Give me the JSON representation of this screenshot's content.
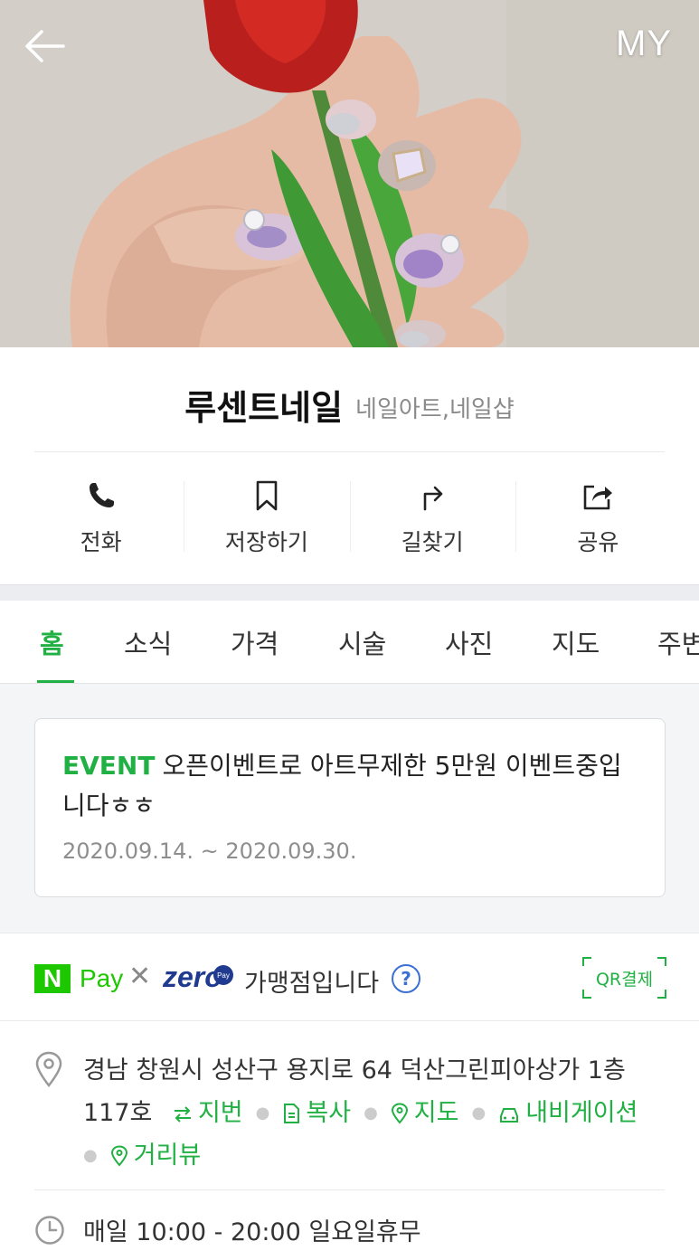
{
  "header": {
    "my_label": "MY"
  },
  "place": {
    "name": "루센트네일",
    "category": "네일아트,네일샵"
  },
  "actions": [
    {
      "label": "전화",
      "icon": "phone-icon"
    },
    {
      "label": "저장하기",
      "icon": "bookmark-icon"
    },
    {
      "label": "길찾기",
      "icon": "directions-icon"
    },
    {
      "label": "공유",
      "icon": "share-icon"
    }
  ],
  "tabs": [
    {
      "label": "홈",
      "active": true
    },
    {
      "label": "소식"
    },
    {
      "label": "가격"
    },
    {
      "label": "시술"
    },
    {
      "label": "사진"
    },
    {
      "label": "지도"
    },
    {
      "label": "주변"
    }
  ],
  "event": {
    "tag": "EVENT",
    "text": "오픈이벤트로 아트무제한 5만원 이벤트중입니다ㅎㅎ",
    "date": "2020.09.14. ~ 2020.09.30."
  },
  "pay": {
    "npay_logo": "N",
    "npay_text": "Pay",
    "times": "✕",
    "zero_text": "zero",
    "zero_badge": "Pay",
    "member_text": "가맹점입니다",
    "help": "?",
    "qr_label": "QR결제"
  },
  "address": {
    "text": "경남 창원시 성산구 용지로 64 덕산그린피아상가 1층 117호",
    "links": [
      "지번",
      "복사",
      "지도",
      "내비게이션",
      "거리뷰"
    ]
  },
  "hours": {
    "text": "매일 10:00 - 20:00 일요일휴무"
  },
  "colors": {
    "accent": "#21b043",
    "npay": "#1ec800",
    "zeropay": "#1f3a8f"
  }
}
